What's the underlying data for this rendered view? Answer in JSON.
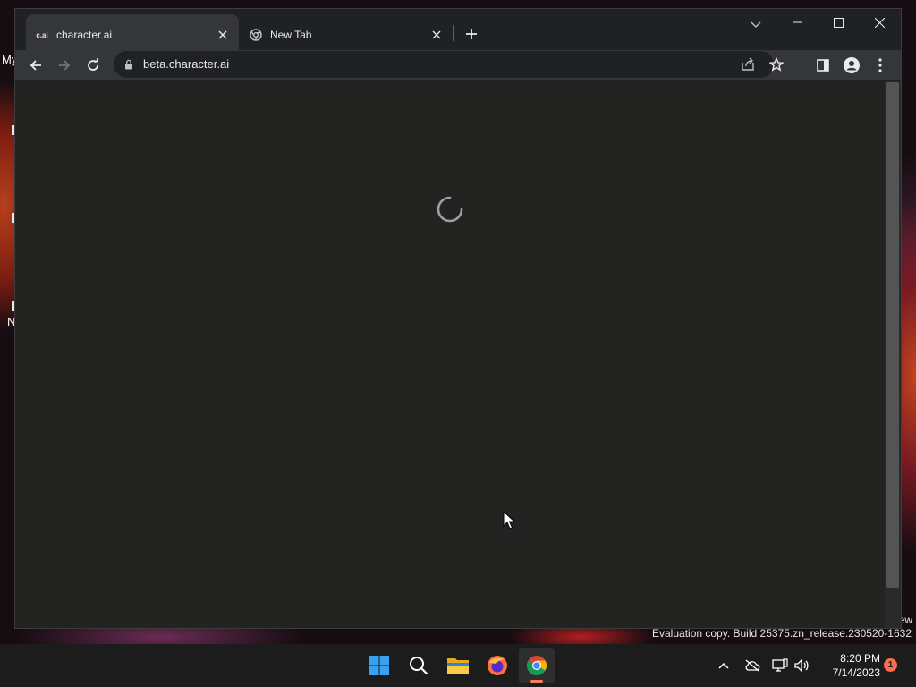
{
  "desktop": {
    "fragments": [
      "My",
      "N"
    ],
    "watermark": "Evaluation copy. Build 25375.zn_release.230520-1632",
    "watermark_fragment": "ew"
  },
  "browser": {
    "tabs": [
      {
        "favicon_text": "c.ai",
        "title": "character.ai",
        "active": true
      },
      {
        "favicon": "chrome-icon",
        "title": "New Tab",
        "active": false
      }
    ],
    "url": "beta.character.ai",
    "theme": {
      "frame": "#202124",
      "toolbar": "#35363a",
      "content": "#232322",
      "text": "#e8eaed"
    }
  },
  "page": {
    "state": "loading",
    "indicator": "spinner-icon"
  },
  "taskbar": {
    "apps": [
      "start-icon",
      "search-icon",
      "file-explorer-icon",
      "firefox-icon",
      "chrome-icon"
    ],
    "active_app": "chrome-icon",
    "time": "8:20 PM",
    "date": "7/14/2023",
    "notification_count": "1",
    "accent": "#ff7a59"
  }
}
